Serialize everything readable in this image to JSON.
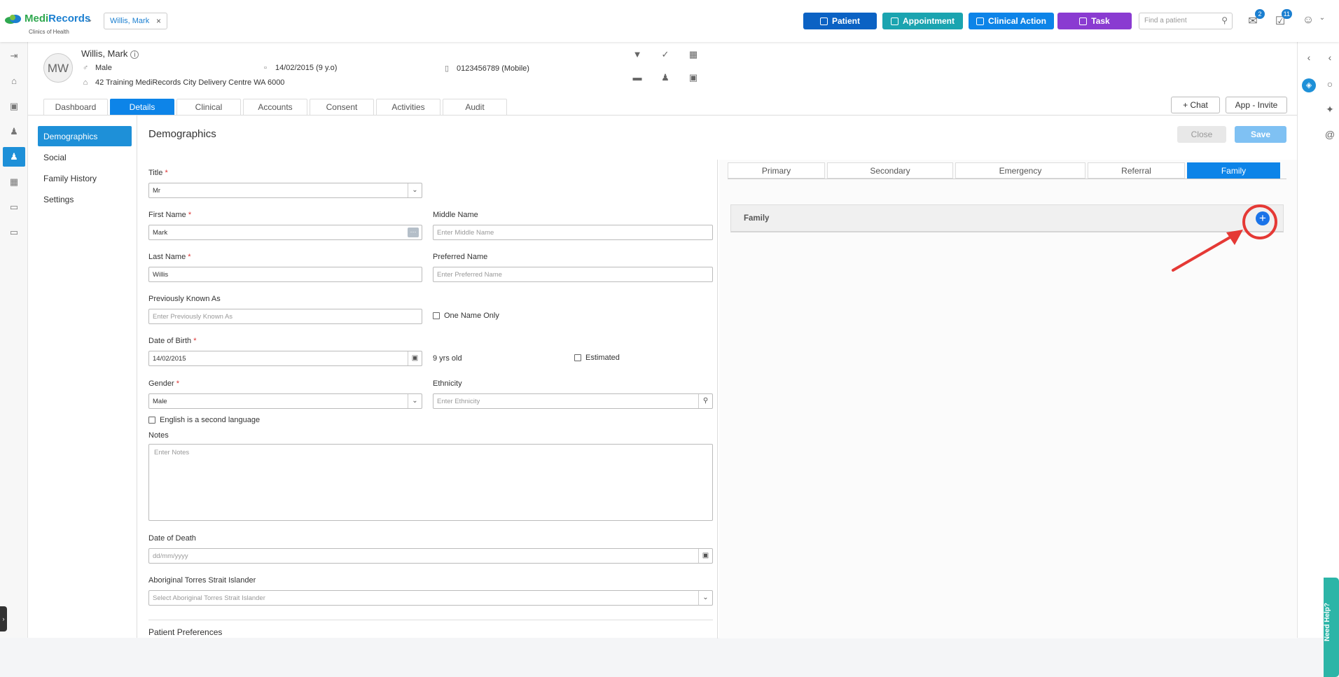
{
  "brand": {
    "name_part1": "Medi",
    "name_part2": "Records",
    "subtitle": "Clinics of Health"
  },
  "patient_chip": "Willis, Mark",
  "top_buttons": [
    {
      "label": "Patient",
      "color": "#0b62c4"
    },
    {
      "label": "Appointment",
      "color": "#1ba4b0"
    },
    {
      "label": "Clinical Action",
      "color": "#0d84e8"
    },
    {
      "label": "Task",
      "color": "#8a3bd1"
    }
  ],
  "search": {
    "placeholder": "Find a patient"
  },
  "badges": {
    "mail": "2",
    "tasks": "11"
  },
  "patient": {
    "initials": "MW",
    "name": "Willis, Mark",
    "gender": "Male",
    "dob": "14/02/2015 (9 y.o)",
    "phone": "0123456789 (Mobile)",
    "address": "42 Training MediRecords City Delivery Centre WA 6000"
  },
  "tabs": [
    "Dashboard",
    "Details",
    "Clinical",
    "Accounts",
    "Consent",
    "Activities",
    "Audit"
  ],
  "active_tab": "Details",
  "header_buttons": {
    "chat": "Chat",
    "app_invite": "App - Invite"
  },
  "sidenav": [
    "Demographics",
    "Social",
    "Family History",
    "Settings"
  ],
  "page_title": "Demographics",
  "actions": {
    "close": "Close",
    "save": "Save"
  },
  "form": {
    "title_label": "Title",
    "title_value": "Mr",
    "first_name_label": "First Name",
    "first_name_value": "Mark",
    "middle_name_label": "Middle Name",
    "middle_name_placeholder": "Enter Middle Name",
    "last_name_label": "Last Name",
    "last_name_value": "Willis",
    "preferred_name_label": "Preferred Name",
    "preferred_name_placeholder": "Enter Preferred Name",
    "prev_known_label": "Previously Known As",
    "prev_known_placeholder": "Enter Previously Known As",
    "one_name_only": "One Name Only",
    "dob_label": "Date of Birth",
    "dob_value": "14/02/2015",
    "age": "9 yrs old",
    "estimated": "Estimated",
    "gender_label": "Gender",
    "gender_value": "Male",
    "ethnicity_label": "Ethnicity",
    "ethnicity_placeholder": "Enter Ethnicity",
    "english_second": "English is a second language",
    "notes_label": "Notes",
    "notes_placeholder": "Enter Notes",
    "dod_label": "Date of Death",
    "dod_placeholder": "dd/mm/yyyy",
    "atsi_label": "Aboriginal Torres Strait Islander",
    "atsi_placeholder": "Select Aboriginal Torres Strait Islander",
    "patient_prefs": "Patient Preferences",
    "required_mark": "*"
  },
  "contact_tabs": [
    "Primary",
    "Secondary",
    "Emergency",
    "Referral",
    "Family"
  ],
  "active_contact_tab": "Family",
  "family_panel": {
    "label": "Family",
    "add_symbol": "+"
  },
  "help_tab": "Need Help?"
}
